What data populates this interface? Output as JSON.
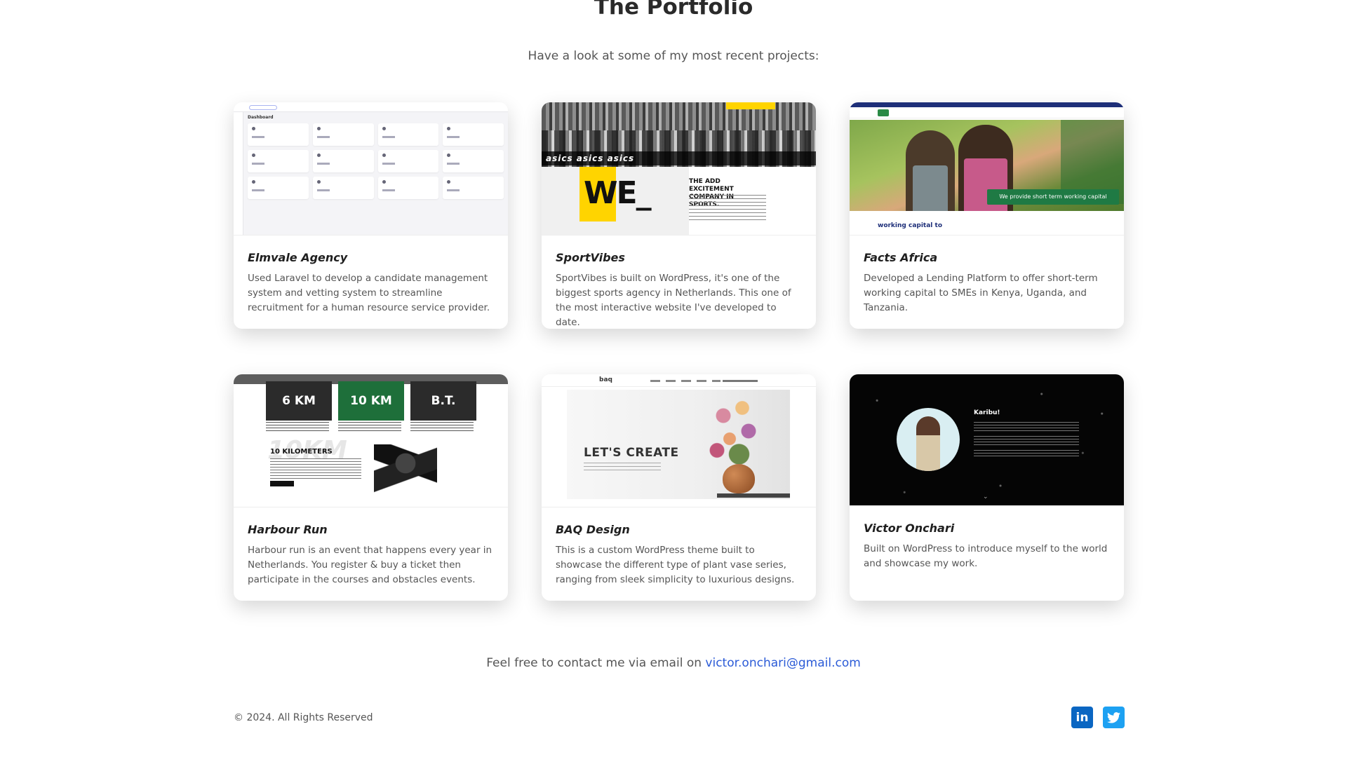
{
  "header": {
    "title": "The Portfolio",
    "subtitle": "Have a look at some of my most recent projects:"
  },
  "projects": [
    {
      "title": "Elmvale Agency",
      "description": "Used Laravel to develop a candidate management system and vetting system to streamline recruitment for a human resource service provider.",
      "thumb_text": "Dashboard"
    },
    {
      "title": "SportVibes",
      "description": "SportVibes is built on WordPress, it's one of the biggest sports agency in Netherlands. This one of the most interactive website I've developed to date.",
      "thumb_text": "WE_",
      "thumb_heading": "THE ADD EXCITEMENT COMPANY IN SPORTS.",
      "thumb_banner": "asics asics asics"
    },
    {
      "title": "Facts Africa",
      "description": "Developed a Lending Platform to offer short-term working capital to SMEs in Kenya, Uganda, and Tanzania.",
      "thumb_cta": "We provide short term working capital",
      "thumb_text": "working capital to"
    },
    {
      "title": "Harbour Run",
      "description": "Harbour run is an event that happens every year in Netherlands. You register & buy a ticket then participate in the courses and obstacles events.",
      "thumb_boxes": [
        "6 KM",
        "10 KM",
        "B.T."
      ],
      "thumb_big": "10KM",
      "thumb_text": "10 KILOMETERS"
    },
    {
      "title": "BAQ Design",
      "description": "This is a custom WordPress theme built to showcase the different type of plant vase series, ranging from sleek simplicity to luxurious designs.",
      "thumb_logo": "baq",
      "thumb_text": "LET'S CREATE"
    },
    {
      "title": "Victor Onchari",
      "description": "Built on WordPress to introduce myself to the world and showcase my work.",
      "thumb_text": "Karibu!"
    }
  ],
  "contact": {
    "prefix": "Feel free to contact me via email on ",
    "email": "victor.onchari@gmail.com"
  },
  "footer": {
    "copyright": "© 2024. All Rights Reserved",
    "linkedin_glyph": "in",
    "twitter_glyph": "t"
  },
  "colors": {
    "link": "#2b5bd7",
    "linkedin": "#0a66c2",
    "twitter": "#1da1f2"
  }
}
